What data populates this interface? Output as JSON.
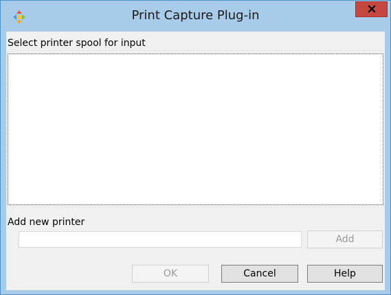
{
  "window": {
    "title": "Print Capture Plug-in",
    "app_icon": "plugin-app-icon",
    "close_icon": "close-icon"
  },
  "spool": {
    "label": "Select printer spool for input",
    "items": []
  },
  "add_printer": {
    "label": "Add new printer",
    "input_value": "",
    "add_label": "Add",
    "add_enabled": false
  },
  "footer": {
    "ok_label": "OK",
    "ok_enabled": false,
    "cancel_label": "Cancel",
    "help_label": "Help"
  },
  "colors": {
    "title_bar": "#a7cbe8",
    "close_button": "#c5473f",
    "dialog_background": "#f0f0f0"
  }
}
